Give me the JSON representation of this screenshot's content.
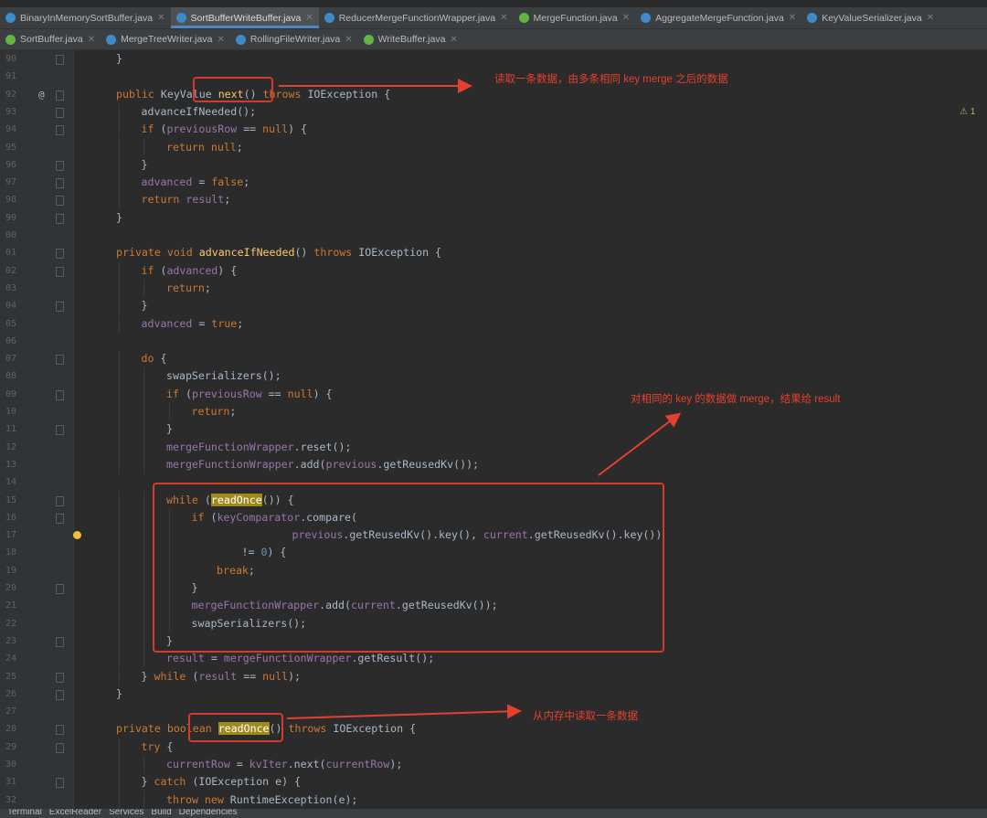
{
  "tabs_row1": [
    {
      "label": "BinaryInMemorySortBuffer.java",
      "icon": "c",
      "active": false
    },
    {
      "label": "SortBufferWriteBuffer.java",
      "icon": "c",
      "active": true
    },
    {
      "label": "ReducerMergeFunctionWrapper.java",
      "icon": "c",
      "active": false
    },
    {
      "label": "MergeFunction.java",
      "icon": "i",
      "active": false
    },
    {
      "label": "AggregateMergeFunction.java",
      "icon": "c",
      "active": false
    },
    {
      "label": "KeyValueSerializer.java",
      "icon": "c",
      "active": false
    }
  ],
  "tabs_row2": [
    {
      "label": "SortBuffer.java",
      "icon": "i",
      "active": false
    },
    {
      "label": "MergeTreeWriter.java",
      "icon": "c",
      "active": false
    },
    {
      "label": "RollingFileWriter.java",
      "icon": "c",
      "active": false
    },
    {
      "label": "WriteBuffer.java",
      "icon": "i",
      "active": false
    }
  ],
  "lines": [
    {
      "n": "90",
      "ind": 1,
      "h": "}",
      "fold": true
    },
    {
      "n": "91",
      "ind": 0,
      "h": "",
      "fold": false
    },
    {
      "n": "92",
      "ind": 1,
      "h": "<span class=\"kw\">public</span> KeyValue <span class=\"fn\">next</span>() <span class=\"kw\">throws</span> IOException {",
      "fold": true,
      "at": true
    },
    {
      "n": "93",
      "ind": 2,
      "h": "advanceIfNeeded();",
      "fold": true
    },
    {
      "n": "94",
      "ind": 2,
      "h": "<span class=\"kw\">if</span> (<span class=\"fld\">previousRow</span> == <span class=\"kw\">null</span>) {",
      "fold": true
    },
    {
      "n": "95",
      "ind": 3,
      "h": "<span class=\"kw\">return null</span>;",
      "fold": false
    },
    {
      "n": "96",
      "ind": 2,
      "h": "}",
      "fold": true
    },
    {
      "n": "97",
      "ind": 2,
      "h": "<span class=\"fld\">advanced</span> = <span class=\"kw\">false</span>;",
      "fold": true
    },
    {
      "n": "98",
      "ind": 2,
      "h": "<span class=\"kw\">return</span> <span class=\"fld\">result</span>;",
      "fold": true
    },
    {
      "n": "99",
      "ind": 1,
      "h": "}",
      "fold": true
    },
    {
      "n": "00",
      "ind": 0,
      "h": "",
      "fold": false
    },
    {
      "n": "01",
      "ind": 1,
      "h": "<span class=\"kw\">private void</span> <span class=\"fn\">advanceIfNeeded</span>() <span class=\"kw\">throws</span> IOException {",
      "fold": true
    },
    {
      "n": "02",
      "ind": 2,
      "h": "<span class=\"kw\">if</span> (<span class=\"fld\">advanced</span>) {",
      "fold": true
    },
    {
      "n": "03",
      "ind": 3,
      "h": "<span class=\"kw\">return</span>;",
      "fold": false
    },
    {
      "n": "04",
      "ind": 2,
      "h": "}",
      "fold": true
    },
    {
      "n": "05",
      "ind": 2,
      "h": "<span class=\"fld\">advanced</span> = <span class=\"kw\">true</span>;",
      "fold": false
    },
    {
      "n": "06",
      "ind": 0,
      "h": "",
      "fold": false
    },
    {
      "n": "07",
      "ind": 2,
      "h": "<span class=\"kw\">do</span> {",
      "fold": true
    },
    {
      "n": "08",
      "ind": 3,
      "h": "swapSerializers();",
      "fold": false
    },
    {
      "n": "09",
      "ind": 3,
      "h": "<span class=\"kw\">if</span> (<span class=\"fld\">previousRow</span> == <span class=\"kw\">null</span>) {",
      "fold": true
    },
    {
      "n": "10",
      "ind": 4,
      "h": "<span class=\"kw\">return</span>;",
      "fold": false
    },
    {
      "n": "11",
      "ind": 3,
      "h": "}",
      "fold": true
    },
    {
      "n": "12",
      "ind": 3,
      "h": "<span class=\"fld\">mergeFunctionWrapper</span>.reset();",
      "fold": false
    },
    {
      "n": "13",
      "ind": 3,
      "h": "<span class=\"fld\">mergeFunctionWrapper</span>.add(<span class=\"fld\">previous</span>.getReusedKv());",
      "fold": false
    },
    {
      "n": "14",
      "ind": 0,
      "h": "",
      "fold": false
    },
    {
      "n": "15",
      "ind": 3,
      "h": "<span class=\"kw\">while</span> (<span class=\"hl\">readOnce</span>()) {",
      "fold": true
    },
    {
      "n": "16",
      "ind": 4,
      "h": "<span class=\"kw\">if</span> (<span class=\"fld\">keyComparator</span>.compare(",
      "fold": true
    },
    {
      "n": "17",
      "ind": 8,
      "h": "<span class=\"fld\">previous</span>.getReusedKv().key(), <span class=\"fld\">current</span>.getReusedKv().key())",
      "fold": false
    },
    {
      "n": "18",
      "ind": 6,
      "h": "!= <span class=\"num\">0</span>) {",
      "fold": false
    },
    {
      "n": "19",
      "ind": 5,
      "h": "<span class=\"kw\">break</span>;",
      "fold": false
    },
    {
      "n": "20",
      "ind": 4,
      "h": "}",
      "fold": true
    },
    {
      "n": "21",
      "ind": 4,
      "h": "<span class=\"fld\">mergeFunctionWrapper</span>.add(<span class=\"fld\">current</span>.getReusedKv());",
      "fold": false
    },
    {
      "n": "22",
      "ind": 4,
      "h": "swapSerializers();",
      "fold": false
    },
    {
      "n": "23",
      "ind": 3,
      "h": "}",
      "fold": true
    },
    {
      "n": "24",
      "ind": 3,
      "h": "<span class=\"fld\">result</span> = <span class=\"fld\">mergeFunctionWrapper</span>.getResult();",
      "fold": false
    },
    {
      "n": "25",
      "ind": 2,
      "h": "} <span class=\"kw\">while</span> (<span class=\"fld\">result</span> == <span class=\"kw\">null</span>);",
      "fold": true
    },
    {
      "n": "26",
      "ind": 1,
      "h": "}",
      "fold": true
    },
    {
      "n": "27",
      "ind": 0,
      "h": "",
      "fold": false
    },
    {
      "n": "28",
      "ind": 1,
      "h": "<span class=\"kw\">private boolean</span> <span class=\"hl\">readOnce</span>() <span class=\"kw\">throws</span> IOException {",
      "fold": true,
      "bulb": true
    },
    {
      "n": "29",
      "ind": 2,
      "h": "<span class=\"kw\">try</span> {",
      "fold": true
    },
    {
      "n": "30",
      "ind": 3,
      "h": "<span class=\"fld\">currentRow</span> = <span class=\"fld\">kvIter</span>.next(<span class=\"fld\">currentRow</span>);",
      "fold": false
    },
    {
      "n": "31",
      "ind": 2,
      "h": "} <span class=\"kw\">catch</span> (IOException e) {",
      "fold": true
    },
    {
      "n": "32",
      "ind": 3,
      "h": "<span class=\"kw\">throw new</span> RuntimeException(e);",
      "fold": false
    }
  ],
  "annotations": {
    "next": "读取一条数据，由多条相同 key merge 之后的数据",
    "merge": "对相同的 key 的数据做 merge，结果给 result",
    "readonce": "从内存中读取一条数据"
  },
  "status_bar": [
    "Terminal",
    "ExcelReader",
    "Services",
    "Build",
    "Dependencies"
  ],
  "colors": {
    "keyword": "#cc7832",
    "method": "#ffc66d",
    "field": "#9876aa",
    "number": "#6897bb",
    "annotation": "#e5402f"
  }
}
